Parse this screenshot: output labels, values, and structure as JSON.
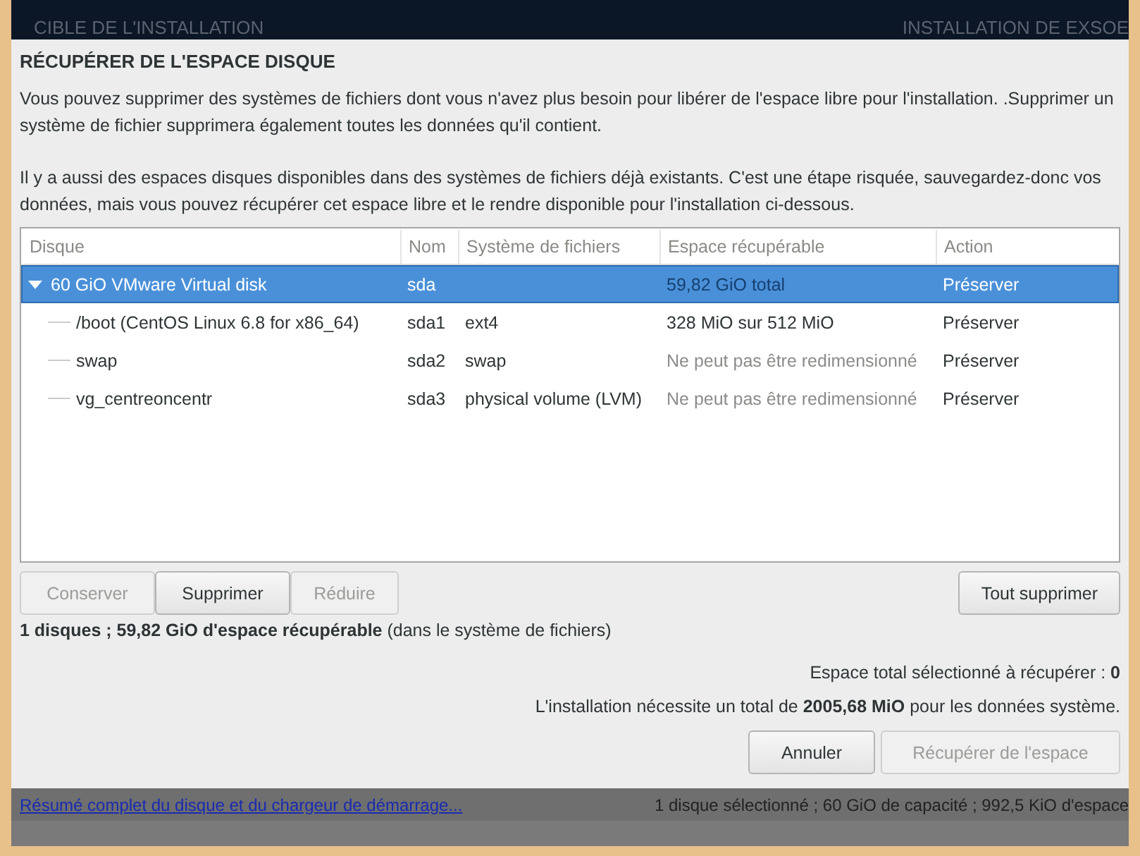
{
  "background": {
    "header_left": "CIBLE DE L'INSTALLATION",
    "header_right": "INSTALLATION DE EXSOE",
    "footer_link": "Résumé complet du disque et du chargeur de démarrage...",
    "footer_info": "1 disque sélectionné ; 60 GiO de capacité ; 992,5 KiO d'espace"
  },
  "dialog": {
    "title": "RÉCUPÉRER DE L'ESPACE DISQUE",
    "paragraphs": [
      "Vous pouvez supprimer des systèmes de fichiers dont vous n'avez plus besoin pour libérer de l'espace libre pour l'installation. .Supprimer un système de fichier supprimera également toutes les données qu'il contient.",
      "Il y a aussi des espaces disques disponibles dans des systèmes de fichiers déjà existants. C'est une étape risquée, sauvegardez-donc vos données, mais vous pouvez récupérer cet espace libre et le rendre disponible pour l'installation ci-dessous."
    ],
    "table": {
      "columns": [
        "Disque",
        "Nom",
        "Système de fichiers",
        "Espace récupérable",
        "Action"
      ],
      "rows": [
        {
          "cells": [
            "60 GiO VMware Virtual disk",
            "sda",
            "",
            "59,82 GiO total",
            "Préserver"
          ],
          "selected": true,
          "expanded": true,
          "children": [
            {
              "cells": [
                "/boot (CentOS Linux 6.8 for x86_64)",
                "sda1",
                "ext4",
                "328 MiO sur 512 MiO",
                "Préserver"
              ],
              "selected": false,
              "resizable": true
            },
            {
              "cells": [
                "swap",
                "sda2",
                "swap",
                "Ne peut pas être redimensionné",
                "Préserver"
              ],
              "selected": false,
              "resizable": false
            },
            {
              "cells": [
                "vg_centreoncentr",
                "sda3",
                "physical volume (LVM)",
                "Ne peut pas être redimensionné",
                "Préserver"
              ],
              "selected": false,
              "resizable": false
            }
          ]
        }
      ]
    },
    "row_actions": [
      {
        "label": "Conserver",
        "disabled": true
      },
      {
        "label": "Supprimer",
        "disabled": false
      },
      {
        "label": "Réduire",
        "disabled": true
      }
    ],
    "delete_all_button": {
      "label": "Tout supprimer"
    },
    "summary": "**1 disques ; 59,82 GiO d'espace récupérable** (dans le système de fichiers)",
    "selected_total": "Espace total sélectionné à récupérer : **0**",
    "required": "L'installation nécessite un total de **2005,68 MiO** pour les données système.",
    "buttons": [
      {
        "label": "Annuler",
        "disabled": false
      },
      {
        "label": "Récupérer de l'espace",
        "disabled": true
      }
    ]
  }
}
